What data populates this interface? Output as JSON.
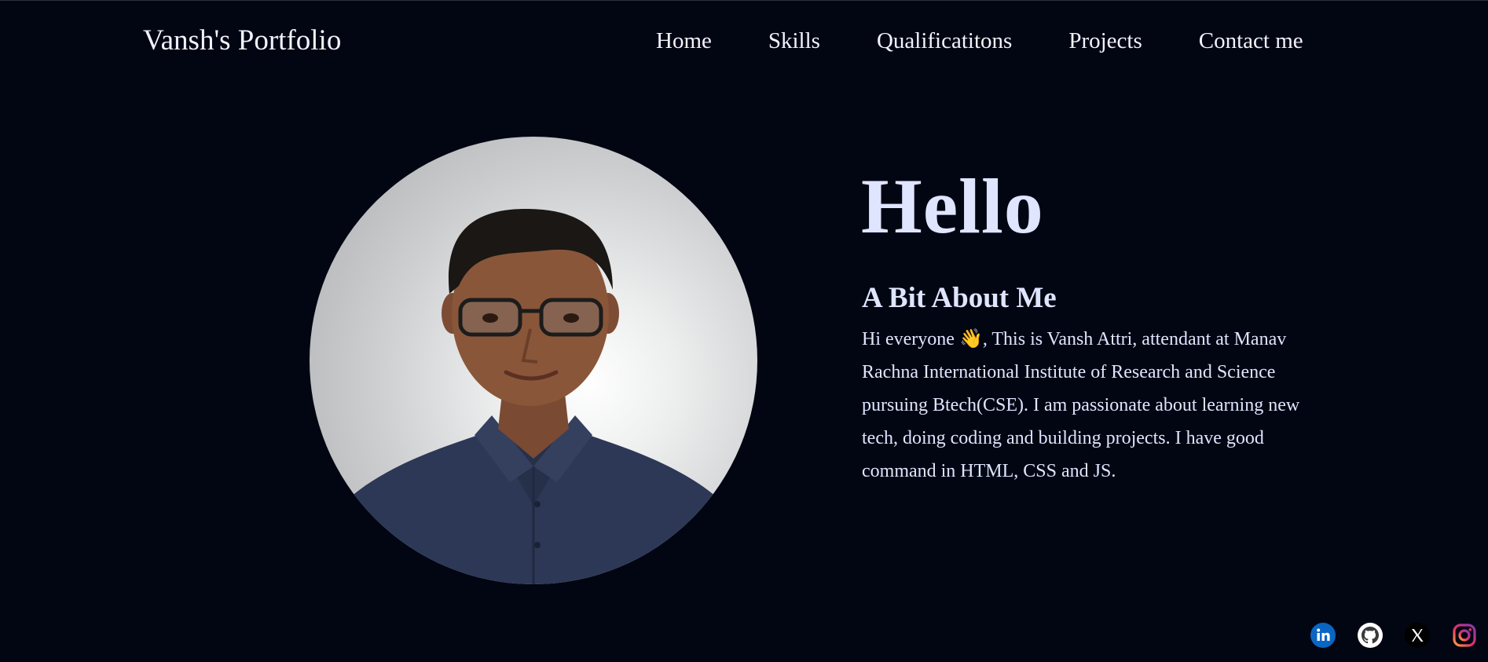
{
  "header": {
    "brand": "Vansh's Portfolio",
    "nav": [
      "Home",
      "Skills",
      "Qualificatitons",
      "Projects",
      "Contact me"
    ]
  },
  "hero": {
    "greeting": "Hello",
    "about_title": "A Bit About Me",
    "about_text": "Hi everyone 👋, This is Vansh Attri, attendant at Manav Rachna International Institute of Research and Science pursuing Btech(CSE). I am passionate about learning new tech, doing coding and building projects. I have good command in HTML, CSS and JS."
  },
  "socials": [
    "linkedin-icon",
    "github-icon",
    "x-icon",
    "instagram-icon"
  ],
  "colors": {
    "background": "#020612",
    "text": "#dfe5ff",
    "linkedin": "#0a66c2",
    "github": "#ffffff",
    "x": "#000000",
    "instagram": "#e1306c"
  }
}
